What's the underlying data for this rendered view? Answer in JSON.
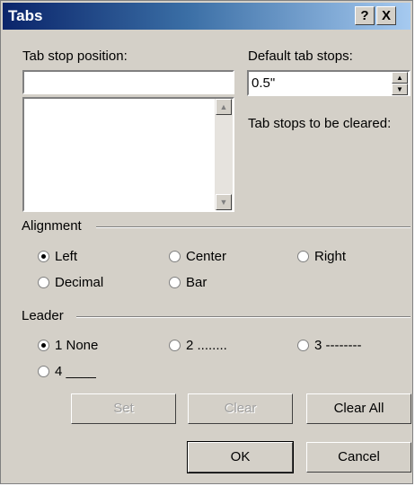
{
  "window": {
    "title": "Tabs",
    "help_label": "?",
    "close_label": "X"
  },
  "tab_stop_position": {
    "label": "Tab stop position:",
    "value": ""
  },
  "default_tab_stops": {
    "label": "Default tab stops:",
    "value": "0.5\""
  },
  "tab_stops_to_be_cleared": {
    "label": "Tab stops to be cleared:"
  },
  "alignment": {
    "label": "Alignment",
    "options": [
      "Left",
      "Center",
      "Right",
      "Decimal",
      "Bar"
    ],
    "selected": "Left"
  },
  "leader": {
    "label": "Leader",
    "options": [
      "1 None",
      "2 ........",
      "3 --------",
      "4 ____"
    ],
    "selected": "1 None"
  },
  "buttons": {
    "set": "Set",
    "clear": "Clear",
    "clear_all": "Clear All",
    "ok": "OK",
    "cancel": "Cancel"
  }
}
